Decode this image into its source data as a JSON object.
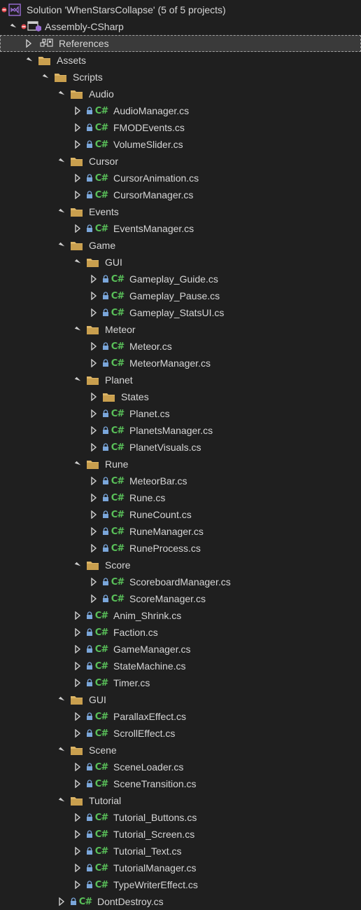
{
  "tree": {
    "solution_label": "Solution 'WhenStarsCollapse' (5 of 5 projects)",
    "project_label": "Assembly-CSharp",
    "references_label": "References",
    "cs_glyph": "C#",
    "items": [
      {
        "label": "Assets",
        "type": "folder",
        "level": 1,
        "expanded": true
      },
      {
        "label": "Scripts",
        "type": "folder",
        "level": 2,
        "expanded": true
      },
      {
        "label": "Audio",
        "type": "folder",
        "level": 3,
        "expanded": true
      },
      {
        "label": "AudioManager.cs",
        "type": "cs",
        "level": 4
      },
      {
        "label": "FMODEvents.cs",
        "type": "cs",
        "level": 4
      },
      {
        "label": "VolumeSlider.cs",
        "type": "cs",
        "level": 4
      },
      {
        "label": "Cursor",
        "type": "folder",
        "level": 3,
        "expanded": true
      },
      {
        "label": "CursorAnimation.cs",
        "type": "cs",
        "level": 4
      },
      {
        "label": "CursorManager.cs",
        "type": "cs",
        "level": 4
      },
      {
        "label": "Events",
        "type": "folder",
        "level": 3,
        "expanded": true
      },
      {
        "label": "EventsManager.cs",
        "type": "cs",
        "level": 4
      },
      {
        "label": "Game",
        "type": "folder",
        "level": 3,
        "expanded": true
      },
      {
        "label": "GUI",
        "type": "folder",
        "level": 4,
        "expanded": true
      },
      {
        "label": "Gameplay_Guide.cs",
        "type": "cs",
        "level": 5
      },
      {
        "label": "Gameplay_Pause.cs",
        "type": "cs",
        "level": 5
      },
      {
        "label": "Gameplay_StatsUI.cs",
        "type": "cs",
        "level": 5
      },
      {
        "label": "Meteor",
        "type": "folder",
        "level": 4,
        "expanded": true
      },
      {
        "label": "Meteor.cs",
        "type": "cs",
        "level": 5
      },
      {
        "label": "MeteorManager.cs",
        "type": "cs",
        "level": 5
      },
      {
        "label": "Planet",
        "type": "folder",
        "level": 4,
        "expanded": true
      },
      {
        "label": "States",
        "type": "folder",
        "level": 5,
        "expanded": false
      },
      {
        "label": "Planet.cs",
        "type": "cs",
        "level": 5
      },
      {
        "label": "PlanetsManager.cs",
        "type": "cs",
        "level": 5
      },
      {
        "label": "PlanetVisuals.cs",
        "type": "cs",
        "level": 5
      },
      {
        "label": "Rune",
        "type": "folder",
        "level": 4,
        "expanded": true
      },
      {
        "label": "MeteorBar.cs",
        "type": "cs",
        "level": 5
      },
      {
        "label": "Rune.cs",
        "type": "cs",
        "level": 5
      },
      {
        "label": "RuneCount.cs",
        "type": "cs",
        "level": 5
      },
      {
        "label": "RuneManager.cs",
        "type": "cs",
        "level": 5
      },
      {
        "label": "RuneProcess.cs",
        "type": "cs",
        "level": 5
      },
      {
        "label": "Score",
        "type": "folder",
        "level": 4,
        "expanded": true
      },
      {
        "label": "ScoreboardManager.cs",
        "type": "cs",
        "level": 5
      },
      {
        "label": "ScoreManager.cs",
        "type": "cs",
        "level": 5
      },
      {
        "label": "Anim_Shrink.cs",
        "type": "cs",
        "level": 4
      },
      {
        "label": "Faction.cs",
        "type": "cs",
        "level": 4
      },
      {
        "label": "GameManager.cs",
        "type": "cs",
        "level": 4
      },
      {
        "label": "StateMachine.cs",
        "type": "cs",
        "level": 4
      },
      {
        "label": "Timer.cs",
        "type": "cs",
        "level": 4
      },
      {
        "label": "GUI",
        "type": "folder",
        "level": 3,
        "expanded": true
      },
      {
        "label": "ParallaxEffect.cs",
        "type": "cs",
        "level": 4
      },
      {
        "label": "ScrollEffect.cs",
        "type": "cs",
        "level": 4
      },
      {
        "label": "Scene",
        "type": "folder",
        "level": 3,
        "expanded": true
      },
      {
        "label": "SceneLoader.cs",
        "type": "cs",
        "level": 4
      },
      {
        "label": "SceneTransition.cs",
        "type": "cs",
        "level": 4
      },
      {
        "label": "Tutorial",
        "type": "folder",
        "level": 3,
        "expanded": true
      },
      {
        "label": "Tutorial_Buttons.cs",
        "type": "cs",
        "level": 4
      },
      {
        "label": "Tutorial_Screen.cs",
        "type": "cs",
        "level": 4
      },
      {
        "label": "Tutorial_Text.cs",
        "type": "cs",
        "level": 4
      },
      {
        "label": "TutorialManager.cs",
        "type": "cs",
        "level": 4
      },
      {
        "label": "TypeWriterEffect.cs",
        "type": "cs",
        "level": 4
      },
      {
        "label": "DontDestroy.cs",
        "type": "cs",
        "level": 3
      }
    ]
  },
  "colors": {
    "background": "#1f1f1f",
    "text": "#d6d6d6",
    "selected_bg": "#3a3a3a",
    "folder": "#dcb567",
    "csharp": "#59c059",
    "lock": "#7aa6da",
    "vs_purple": "#9b6fd6",
    "error_red": "#e0474c"
  }
}
